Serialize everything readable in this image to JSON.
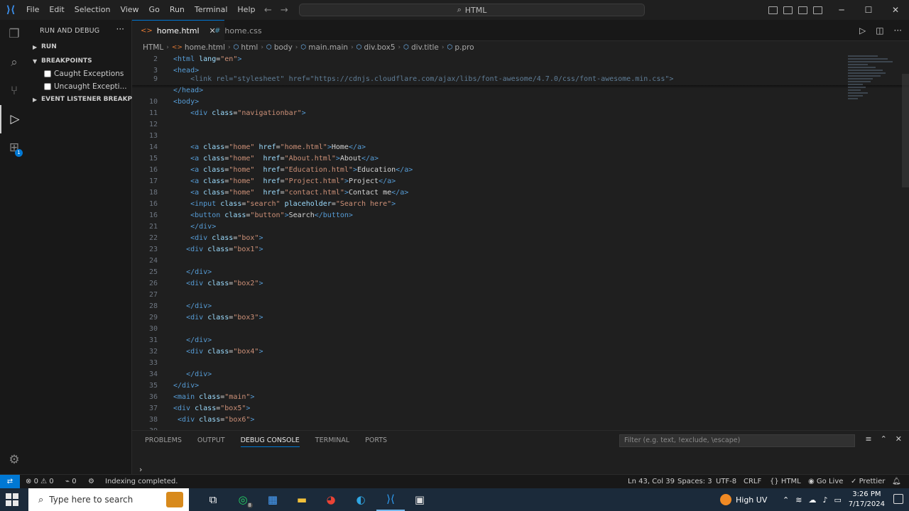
{
  "window": {
    "menu": [
      "File",
      "Edit",
      "Selection",
      "View",
      "Go",
      "Run",
      "Terminal",
      "Help"
    ],
    "search_text": "HTML",
    "controls": {
      "minimize": "─",
      "maximize": "☐",
      "close": "✕"
    }
  },
  "sidebar": {
    "title": "RUN AND DEBUG",
    "more": "···",
    "run_label": "RUN",
    "breakpoints_label": "BREAKPOINTS",
    "breakpoints": [
      "Caught Exceptions",
      "Uncaught Excepti..."
    ],
    "event_listener_label": "EVENT LISTENER BREAKPOI..."
  },
  "tabs": [
    {
      "label": "home.html",
      "active": true,
      "icon": "html-file-icon"
    },
    {
      "label": "home.css",
      "active": false,
      "icon": "css-file-icon"
    }
  ],
  "breadcrumb": [
    "HTML",
    "home.html",
    "html",
    "body",
    "main.main",
    "div.box5",
    "div.title",
    "p.pro"
  ],
  "code_lines": [
    {
      "ln": "2",
      "html": "<span class='tag'>&lt;html</span> <span class='attr'>lang</span>=<span class='str'>\"en\"</span><span class='tag'>&gt;</span>"
    },
    {
      "ln": "3",
      "html": "<span class='tag'>&lt;head&gt;</span>"
    },
    {
      "ln": "9",
      "html": "    <span class='dim'>&lt;link rel=\"stylesheet\" href=\"https://cdnjs.cloudflare.com/ajax/libs/font-awesome/4.7.0/css/font-awesome.min.css\"&gt;</span>"
    },
    {
      "ln": "",
      "html": "<span class='tag'>&lt;/head&gt;</span>"
    },
    {
      "ln": "10",
      "html": "<span class='tag'>&lt;body&gt;</span>"
    },
    {
      "ln": "11",
      "html": "    <span class='tag'>&lt;div</span> <span class='attr'>class</span>=<span class='str'>\"navigationbar\"</span><span class='tag'>&gt;</span>"
    },
    {
      "ln": "12",
      "html": ""
    },
    {
      "ln": "13",
      "html": ""
    },
    {
      "ln": "14",
      "html": "    <span class='tag'>&lt;a</span> <span class='attr'>class</span>=<span class='str'>\"home\"</span> <span class='attr'>href</span>=<span class='str'>\"home.html\"</span><span class='tag'>&gt;</span><span class='txt'>Home</span><span class='tag'>&lt;/a&gt;</span>"
    },
    {
      "ln": "15",
      "html": "    <span class='tag'>&lt;a</span> <span class='attr'>class</span>=<span class='str'>\"home\"</span>  <span class='attr'>href</span>=<span class='str'>\"About.html\"</span><span class='tag'>&gt;</span><span class='txt'>About</span><span class='tag'>&lt;/a&gt;</span>"
    },
    {
      "ln": "16",
      "html": "    <span class='tag'>&lt;a</span> <span class='attr'>class</span>=<span class='str'>\"home\"</span>  <span class='attr'>href</span>=<span class='str'>\"Education.html\"</span><span class='tag'>&gt;</span><span class='txt'>Education</span><span class='tag'>&lt;/a&gt;</span>"
    },
    {
      "ln": "17",
      "html": "    <span class='tag'>&lt;a</span> <span class='attr'>class</span>=<span class='str'>\"home\"</span>  <span class='attr'>href</span>=<span class='str'>\"Project.html\"</span><span class='tag'>&gt;</span><span class='txt'>Project</span><span class='tag'>&lt;/a&gt;</span>"
    },
    {
      "ln": "18",
      "html": "    <span class='tag'>&lt;a</span> <span class='attr'>class</span>=<span class='str'>\"home\"</span>  <span class='attr'>href</span>=<span class='str'>\"contact.html\"</span><span class='tag'>&gt;</span><span class='txt'>Contact me</span><span class='tag'>&lt;/a&gt;</span>"
    },
    {
      "ln": "16",
      "html": "    <span class='tag'>&lt;input</span> <span class='attr'>class</span>=<span class='str'>\"search\"</span> <span class='attr'>placeholder</span>=<span class='str'>\"Search here\"</span><span class='tag'>&gt;</span>"
    },
    {
      "ln": "16",
      "html": "    <span class='tag'>&lt;button</span> <span class='attr'>class</span>=<span class='str'>\"button\"</span><span class='tag'>&gt;</span><span class='txt'>Search</span><span class='tag'>&lt;/button&gt;</span>"
    },
    {
      "ln": "21",
      "html": "    <span class='tag'>&lt;/div&gt;</span>"
    },
    {
      "ln": "22",
      "html": "    <span class='tag'>&lt;div</span> <span class='attr'>class</span>=<span class='str'>\"box\"</span><span class='tag'>&gt;</span>"
    },
    {
      "ln": "23",
      "html": "   <span class='tag'>&lt;div</span> <span class='attr'>class</span>=<span class='str'>\"box1\"</span><span class='tag'>&gt;</span>"
    },
    {
      "ln": "24",
      "html": ""
    },
    {
      "ln": "25",
      "html": "   <span class='tag'>&lt;/div&gt;</span>"
    },
    {
      "ln": "26",
      "html": "   <span class='tag'>&lt;div</span> <span class='attr'>class</span>=<span class='str'>\"box2\"</span><span class='tag'>&gt;</span>"
    },
    {
      "ln": "27",
      "html": ""
    },
    {
      "ln": "28",
      "html": "   <span class='tag'>&lt;/div&gt;</span>"
    },
    {
      "ln": "29",
      "html": "   <span class='tag'>&lt;div</span> <span class='attr'>class</span>=<span class='str'>\"box3\"</span><span class='tag'>&gt;</span>"
    },
    {
      "ln": "30",
      "html": ""
    },
    {
      "ln": "31",
      "html": "   <span class='tag'>&lt;/div&gt;</span>"
    },
    {
      "ln": "32",
      "html": "   <span class='tag'>&lt;div</span> <span class='attr'>class</span>=<span class='str'>\"box4\"</span><span class='tag'>&gt;</span>"
    },
    {
      "ln": "33",
      "html": ""
    },
    {
      "ln": "34",
      "html": "   <span class='tag'>&lt;/div&gt;</span>"
    },
    {
      "ln": "35",
      "html": "<span class='tag'>&lt;/div&gt;</span>"
    },
    {
      "ln": "36",
      "html": "<span class='tag'>&lt;main</span> <span class='attr'>class</span>=<span class='str'>\"main\"</span><span class='tag'>&gt;</span>"
    },
    {
      "ln": "37",
      "html": "<span class='tag'>&lt;div</span> <span class='attr'>class</span>=<span class='str'>\"box5\"</span><span class='tag'>&gt;</span>"
    },
    {
      "ln": "38",
      "html": " <span class='tag'>&lt;div</span> <span class='attr'>class</span>=<span class='str'>\"box6\"</span><span class='tag'>&gt;</span>"
    },
    {
      "ln": "39",
      "html": ""
    }
  ],
  "panel": {
    "tabs": [
      "PROBLEMS",
      "OUTPUT",
      "DEBUG CONSOLE",
      "TERMINAL",
      "PORTS"
    ],
    "active_tab": "DEBUG CONSOLE",
    "filter_placeholder": "Filter (e.g. text, !exclude, \\escape)",
    "prompt": "›"
  },
  "statusbar": {
    "errors": "0",
    "warnings": "0",
    "ports": "0",
    "message": "Indexing completed.",
    "cursor": "Ln 43, Col 39",
    "spaces": "Spaces: 3",
    "encoding": "UTF-8",
    "eol": "CRLF",
    "language": "HTML",
    "golive": "Go Live",
    "prettier": "Prettier"
  },
  "taskbar": {
    "search_placeholder": "Type here to search",
    "weather": "High UV",
    "time": "3:26 PM",
    "date": "7/17/2024",
    "whatsapp_badge": "8"
  },
  "colors": {
    "accent": "#0078d4",
    "tag": "#569cd6",
    "attr": "#9cdcfe",
    "string": "#ce9178"
  }
}
